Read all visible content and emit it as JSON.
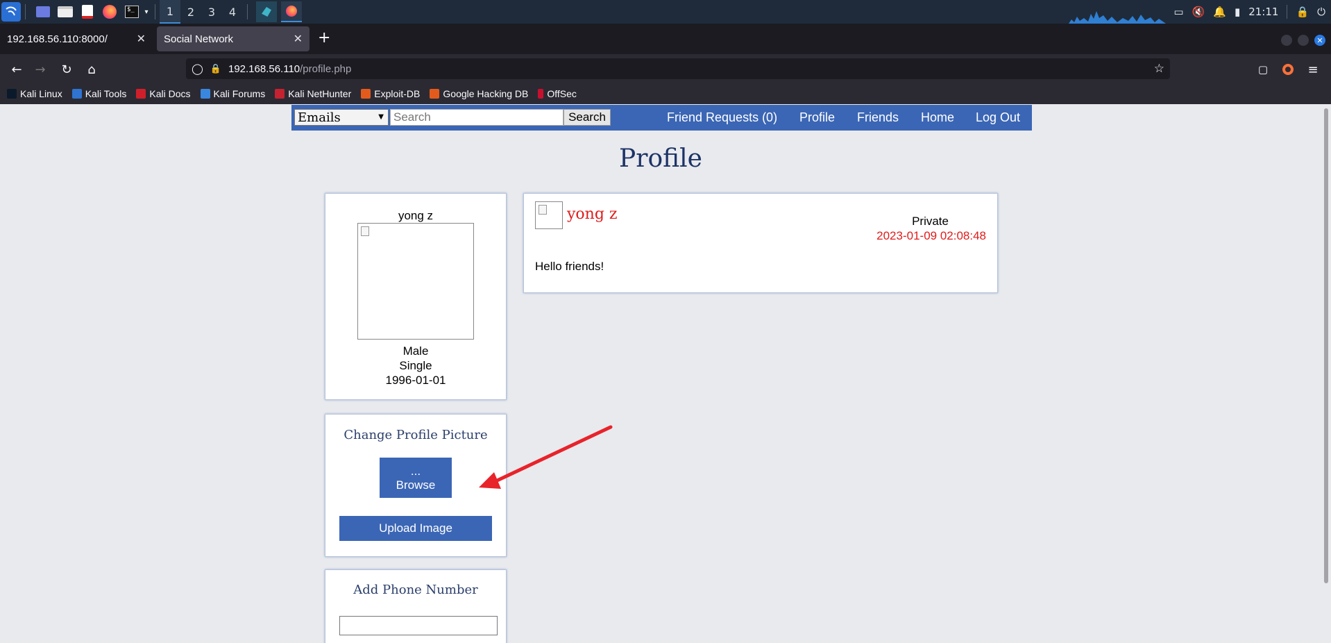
{
  "taskbar": {
    "workspaces": [
      "1",
      "2",
      "3",
      "4"
    ],
    "clock": "21:11"
  },
  "browser": {
    "tabs": [
      {
        "title": "192.168.56.110:8000/"
      },
      {
        "title": "Social Network"
      }
    ],
    "url_host": "192.168.56.110",
    "url_path": "/profile.php",
    "bookmarks": [
      "Kali Linux",
      "Kali Tools",
      "Kali Docs",
      "Kali Forums",
      "Kali NetHunter",
      "Exploit-DB",
      "Google Hacking DB",
      "OffSec"
    ]
  },
  "site_nav": {
    "select_value": "Emails",
    "search_placeholder": "Search",
    "search_button": "Search",
    "links": [
      "Friend Requests (0)",
      "Profile",
      "Friends",
      "Home",
      "Log Out"
    ]
  },
  "page": {
    "title": "Profile"
  },
  "user_card": {
    "name": "yong z",
    "gender": "Male",
    "status": "Single",
    "birthday": "1996-01-01"
  },
  "upload_card": {
    "title": "Change Profile Picture",
    "browse_dots": "...",
    "browse_label": "Browse",
    "upload_label": "Upload Image"
  },
  "phone_card": {
    "title": "Add Phone Number"
  },
  "post": {
    "author": "yong z",
    "privacy": "Private",
    "timestamp": "2023-01-09 02:08:48",
    "body": "Hello friends!"
  },
  "colors": {
    "site_blue": "#3b66b5",
    "accent_red": "#e01b1b",
    "annotation_arrow": "#e8232a"
  }
}
